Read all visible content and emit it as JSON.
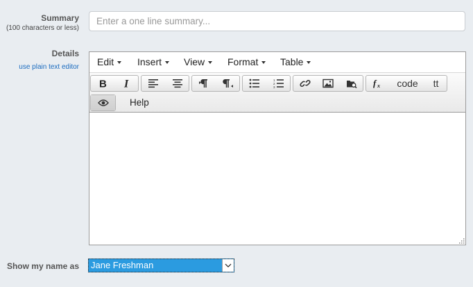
{
  "summary": {
    "label": "Summary",
    "sublabel": "(100 characters or less)",
    "placeholder": "Enter a one line summary...",
    "value": ""
  },
  "details": {
    "label": "Details",
    "plain_text_link": "use plain text editor"
  },
  "editor": {
    "menu": [
      "Edit",
      "Insert",
      "View",
      "Format",
      "Table"
    ],
    "buttons": {
      "code": "code",
      "tt": "tt",
      "help": "Help"
    },
    "icons": [
      "bold-icon",
      "italic-icon",
      "align-left-icon",
      "align-center-icon",
      "ltr-paragraph-icon",
      "rtl-paragraph-icon",
      "bullet-list-icon",
      "numbered-list-icon",
      "link-icon",
      "image-icon",
      "media-browse-icon",
      "formula-icon",
      "preview-eye-icon"
    ]
  },
  "show_name": {
    "label": "Show my name as",
    "selected": "Jane Freshman"
  },
  "colors": {
    "background": "#e9edf1",
    "select_highlight": "#2b9be0",
    "link": "#1a6bbf"
  }
}
